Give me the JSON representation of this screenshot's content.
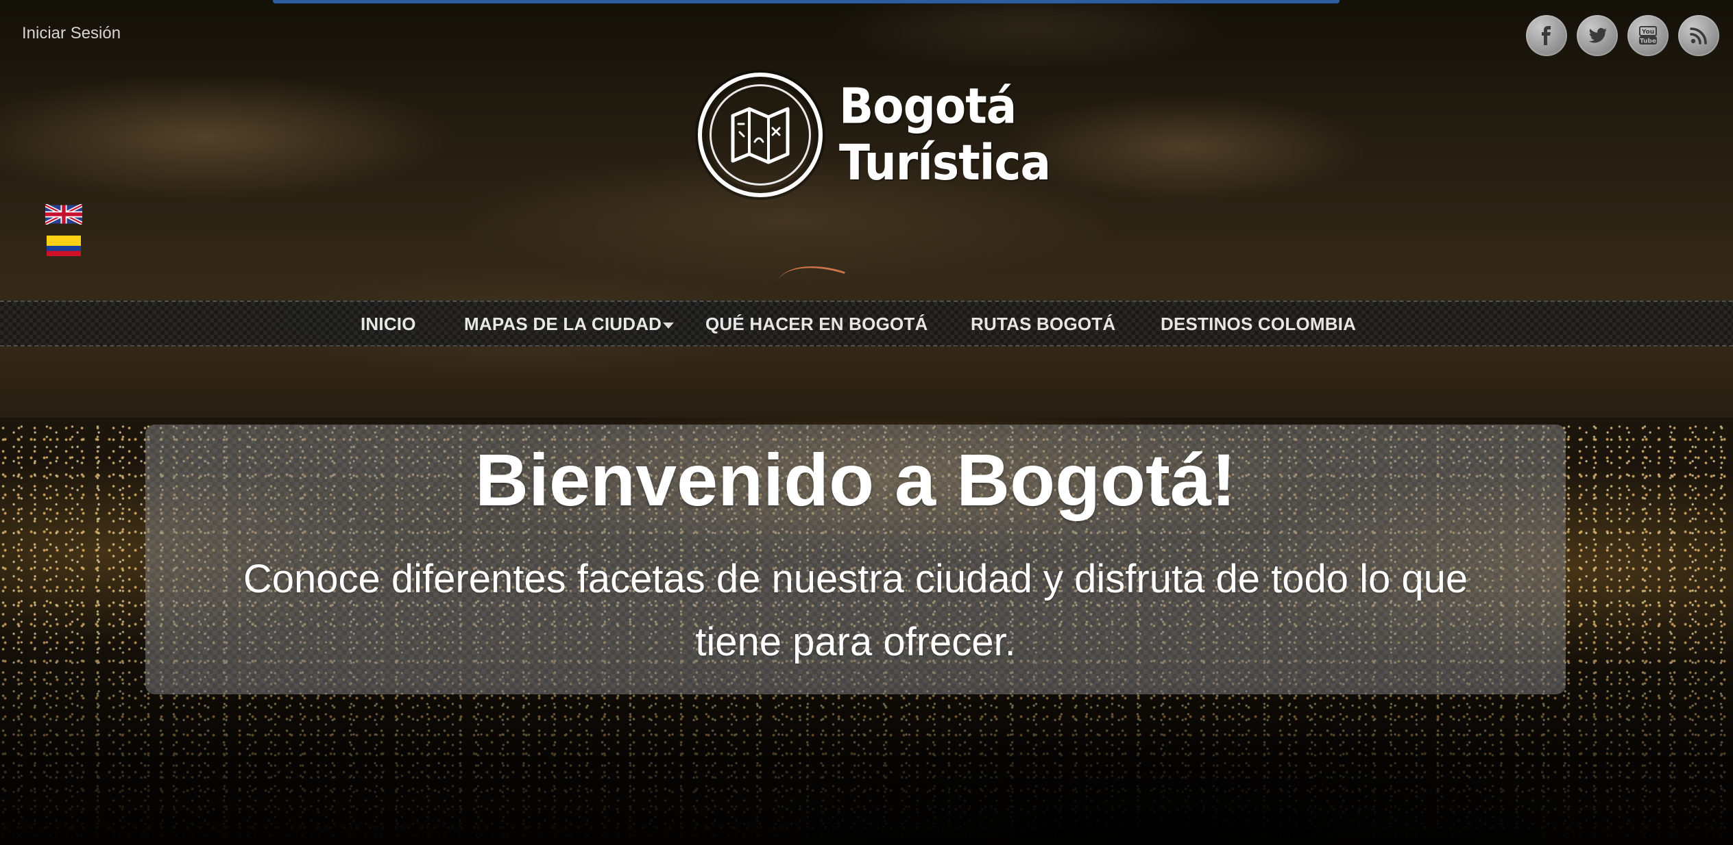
{
  "header": {
    "login_label": "Iniciar Sesión",
    "social": [
      {
        "icon": "facebook-icon"
      },
      {
        "icon": "twitter-icon"
      },
      {
        "icon": "youtube-icon"
      },
      {
        "icon": "rss-icon"
      }
    ],
    "logo": {
      "line1": "Bogotá",
      "line2": "Turística"
    },
    "languages": [
      {
        "icon": "uk-flag-icon"
      },
      {
        "icon": "colombia-flag-icon"
      }
    ]
  },
  "nav": {
    "items": [
      {
        "label": "INICIO"
      },
      {
        "label": "MAPAS DE LA CIUDAD",
        "has_dropdown": true
      },
      {
        "label": "QUÉ HACER EN BOGOTÁ"
      },
      {
        "label": "RUTAS BOGOTÁ"
      },
      {
        "label": "DESTINOS COLOMBIA"
      }
    ]
  },
  "hero": {
    "title": "Bienvenido a Bogotá!",
    "subtitle_line1": "Conoce diferentes facetas de nuestra ciudad y disfruta de todo lo que",
    "subtitle_line2": "tiene para ofrecer."
  },
  "colors": {
    "accent": "#2c5d9e",
    "nav_bg": "#1a1a1a",
    "hero_overlay": "rgba(118,118,118,0.55)"
  }
}
